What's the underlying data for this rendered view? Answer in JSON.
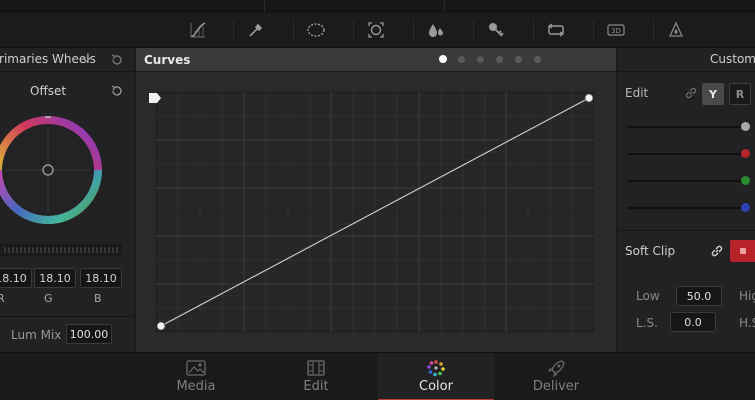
{
  "toolbar": {
    "tools": [
      "curves-icon",
      "qualifier-picker-icon",
      "window-icon",
      "tracker-icon",
      "blur-icon",
      "key-icon",
      "sizing-icon",
      "3d-icon",
      "magic-mask-icon"
    ],
    "badge_3d": "3D"
  },
  "left_panel": {
    "title": "Primaries Wheels",
    "wheel_label": "Offset",
    "values": [
      {
        "value": "18.10",
        "channel": "R"
      },
      {
        "value": "18.10",
        "channel": "G"
      },
      {
        "value": "18.10",
        "channel": "B"
      }
    ],
    "lum_mix_label": "Lum Mix",
    "lum_mix_value": "100.00"
  },
  "curves_panel": {
    "title": "Curves",
    "page_dots": 6,
    "active_dot": 0
  },
  "right_panel": {
    "title": "Custom",
    "edit_label": "Edit",
    "channel_buttons": [
      "Y",
      "R"
    ],
    "slider_colors": [
      "#a9a9a9",
      "#b3262a",
      "#2b8a2f",
      "#2a44b8"
    ],
    "soft_clip_label": "Soft Clip",
    "soft_clip_fields": [
      {
        "label": "Low",
        "value": "50.0"
      },
      {
        "label": "L.S.",
        "value": "0.0"
      }
    ],
    "soft_clip_right_labels": [
      "Hig",
      "H.S"
    ]
  },
  "nav": {
    "items": [
      {
        "label": "Media",
        "icon": "media-icon"
      },
      {
        "label": "Edit",
        "icon": "edit-icon"
      },
      {
        "label": "Color",
        "icon": "color-icon",
        "active": true
      },
      {
        "label": "Deliver",
        "icon": "deliver-icon"
      }
    ]
  },
  "colors": {
    "accent": "#c23a32",
    "panel": "#222224",
    "curve_line": "#d8cfcf"
  }
}
